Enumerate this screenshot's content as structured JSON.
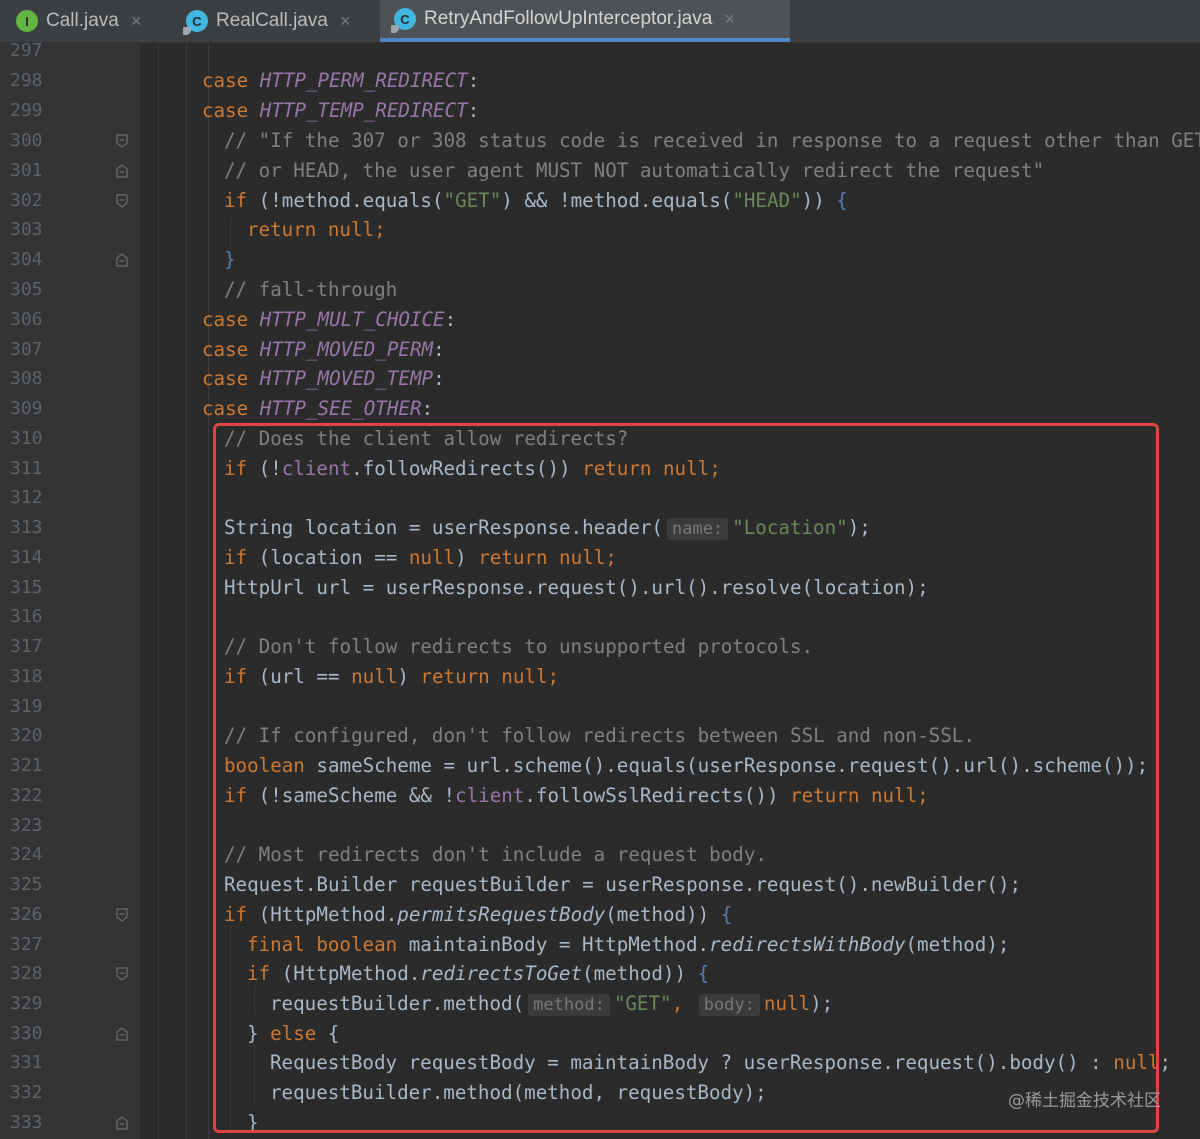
{
  "tabs": [
    {
      "name": "Call.java",
      "icon": "interface-icon",
      "icon_letter": "I",
      "active": false
    },
    {
      "name": "RealCall.java",
      "icon": "class-icon",
      "icon_letter": "C",
      "active": false
    },
    {
      "name": "RetryAndFollowUpInterceptor.java",
      "icon": "class-icon",
      "icon_letter": "C",
      "active": true
    }
  ],
  "close_glyph": "×",
  "lines": [
    {
      "n": "297"
    },
    {
      "n": "298"
    },
    {
      "n": "299"
    },
    {
      "n": "300"
    },
    {
      "n": "301"
    },
    {
      "n": "302"
    },
    {
      "n": "303"
    },
    {
      "n": "304"
    },
    {
      "n": "305"
    },
    {
      "n": "306"
    },
    {
      "n": "307"
    },
    {
      "n": "308"
    },
    {
      "n": "309"
    },
    {
      "n": "310"
    },
    {
      "n": "311"
    },
    {
      "n": "312"
    },
    {
      "n": "313"
    },
    {
      "n": "314"
    },
    {
      "n": "315"
    },
    {
      "n": "316"
    },
    {
      "n": "317"
    },
    {
      "n": "318"
    },
    {
      "n": "319"
    },
    {
      "n": "320"
    },
    {
      "n": "321"
    },
    {
      "n": "322"
    },
    {
      "n": "323"
    },
    {
      "n": "324"
    },
    {
      "n": "325"
    },
    {
      "n": "326"
    },
    {
      "n": "327"
    },
    {
      "n": "328"
    },
    {
      "n": "329"
    },
    {
      "n": "330"
    },
    {
      "n": "331"
    },
    {
      "n": "332"
    },
    {
      "n": "333"
    }
  ],
  "code": {
    "l298": "HTTP_PERM_REDIRECT",
    "l299": "HTTP_TEMP_REDIRECT",
    "l300": "// \"If the 307 or 308 status code is received in response to a request other than GET",
    "l301": "// or HEAD, the user agent MUST NOT automatically redirect the request\"",
    "l302_a": "(!method.equals(",
    "l302_s1": "\"GET\"",
    "l302_b": ") && !method.equals(",
    "l302_s2": "\"HEAD\"",
    "l302_c": ")) ",
    "l303": "return null;",
    "l305": "// fall-through",
    "l306": "HTTP_MULT_CHOICE",
    "l307": "HTTP_MOVED_PERM",
    "l308": "HTTP_MOVED_TEMP",
    "l309": "HTTP_SEE_OTHER",
    "l310": "// Does the client allow redirects?",
    "l311_a": "(!",
    "l311_f": "client",
    "l311_b": ".followRedirects()) ",
    "l313_a": "String location = userResponse.header(",
    "l313_hint": "name:",
    "l313_s": "\"Location\"",
    "l313_b": ");",
    "l314_a": "(location == ",
    "l314_b": ") ",
    "l315": "HttpUrl url = userResponse.request().url().resolve(location);",
    "l317": "// Don't follow redirects to unsupported protocols.",
    "l318_a": "(url == ",
    "l318_b": ") ",
    "l320": "// If configured, don't follow redirects between SSL and non-SSL.",
    "l321_b": " sameScheme = url.scheme().equals(userResponse.request().url().scheme());",
    "l322_a": "(!sameScheme && !",
    "l322_f": "client",
    "l322_b": ".followSslRedirects()) ",
    "l324": "// Most redirects don't include a request body.",
    "l325": "Request.Builder requestBuilder = userResponse.request().newBuilder();",
    "l326_a": "(HttpMethod.",
    "l326_i": "permitsRequestBody",
    "l326_b": "(method)) ",
    "l327_b": " maintainBody = HttpMethod.",
    "l327_i": "redirectsWithBody",
    "l327_c": "(method);",
    "l328_a": "(HttpMethod.",
    "l328_i": "redirectsToGet",
    "l328_b": "(method)) ",
    "l329_a": "requestBuilder.method(",
    "l329_h1": "method:",
    "l329_s": "\"GET\"",
    "l329_h2": "body:",
    "l329_c": ");",
    "l331_a": "RequestBody requestBody = maintainBody ? userResponse.request().body() : ",
    "l332": "requestBuilder.method(method, requestBody);"
  },
  "keywords": {
    "case": "case",
    "if": "if",
    "return": "return",
    "null": "null",
    "boolean": "boolean",
    "final": "final",
    "else": "else",
    "return_null": "return null;"
  },
  "punct": {
    "colon": ":",
    "open_brace": "{",
    "close_brace": "}",
    "semicolon": ";",
    "comma": ","
  },
  "watermark": "@稀土掘金技术社区",
  "colors": {
    "keyword": "#cc7832",
    "constant": "#9876aa",
    "string": "#6a8759",
    "comment": "#808080",
    "highlight_border": "#e0453f",
    "active_tab_underline": "#4a88c7"
  }
}
